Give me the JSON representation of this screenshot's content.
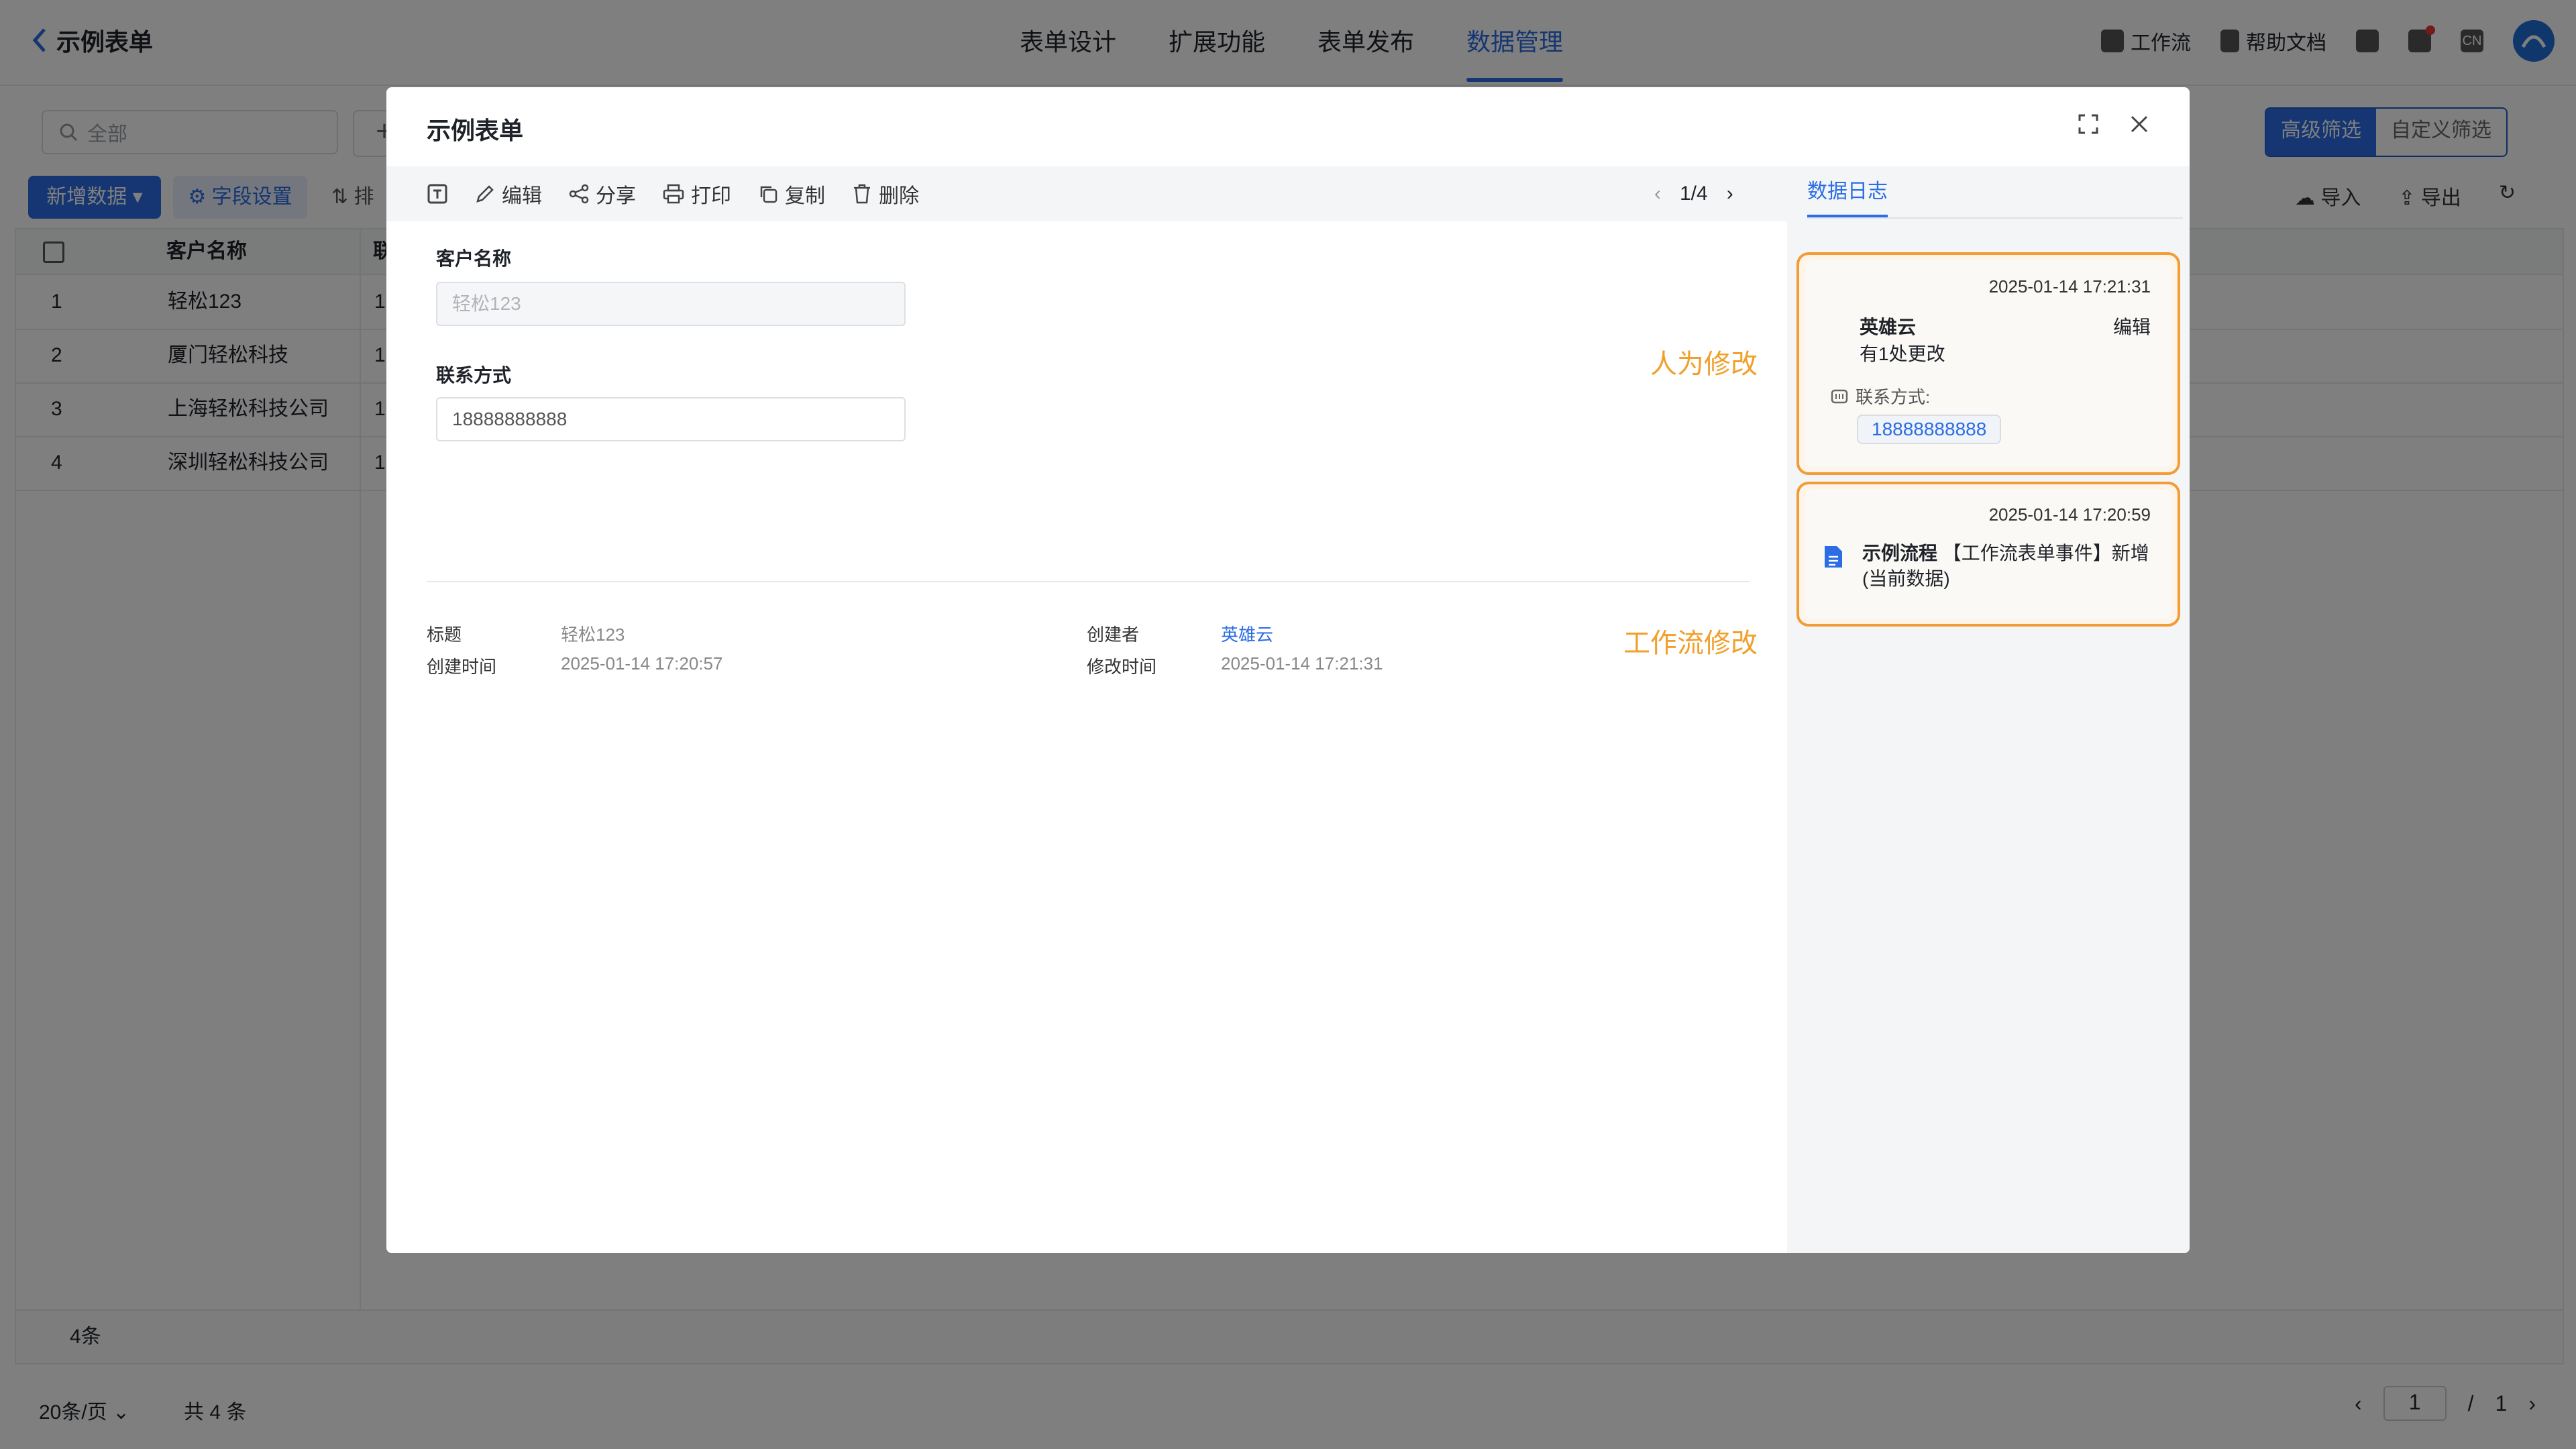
{
  "header": {
    "back_title": "示例表单",
    "nav": [
      "表单设计",
      "扩展功能",
      "表单发布",
      "数据管理"
    ],
    "active_nav": "数据管理",
    "workflow": "工作流",
    "help": "帮助文档",
    "lang": "CN"
  },
  "list": {
    "search_placeholder": "全部",
    "filters": [
      "高级筛选",
      "自定义筛选"
    ],
    "add_button": "新增数据",
    "field_settings": "字段设置",
    "sort": "排",
    "import": "导入",
    "export": "导出",
    "col_name": "客户名称",
    "col_contact_partial": "联",
    "rows": [
      {
        "idx": "1",
        "name": "轻松123",
        "contact": "1"
      },
      {
        "idx": "2",
        "name": "厦门轻松科技",
        "contact": "1"
      },
      {
        "idx": "3",
        "name": "上海轻松科技公司",
        "contact": "1"
      },
      {
        "idx": "4",
        "name": "深圳轻松科技公司",
        "contact": "1"
      }
    ],
    "count": "4条",
    "page_size": "20条/页",
    "total": "共 4 条",
    "page_current": "1",
    "page_sep": "/",
    "page_total": "1"
  },
  "modal": {
    "title": "示例表单",
    "toolbar": [
      "编辑",
      "分享",
      "打印",
      "复制",
      "删除"
    ],
    "pager": "1/4",
    "fields": {
      "customer_label": "客户名称",
      "customer_value": "轻松123",
      "contact_label": "联系方式",
      "contact_value": "18888888888"
    },
    "meta": {
      "title_label": "标题",
      "title_value": "轻松123",
      "created_label": "创建时间",
      "created_value": "2025-01-14 17:20:57",
      "creator_label": "创建者",
      "creator_value": "英雄云",
      "modified_label": "修改时间",
      "modified_value": "2025-01-14 17:21:31"
    },
    "notes": {
      "manual": "人为修改",
      "workflow": "工作流修改"
    },
    "log": {
      "tab": "数据日志",
      "entry1": {
        "time": "2025-01-14 17:21:31",
        "user": "英雄云",
        "action": "编辑",
        "summary": "有1处更改",
        "field": "联系方式:",
        "value": "18888888888"
      },
      "entry2": {
        "time": "2025-01-14 17:20:59",
        "flow_name": "示例流程",
        "flow_event": "【工作流表单事件】新增",
        "flow_tail": "(当前数据)"
      }
    }
  },
  "colors": {
    "accent": "#2b6de5",
    "highlight": "#f39b34"
  }
}
